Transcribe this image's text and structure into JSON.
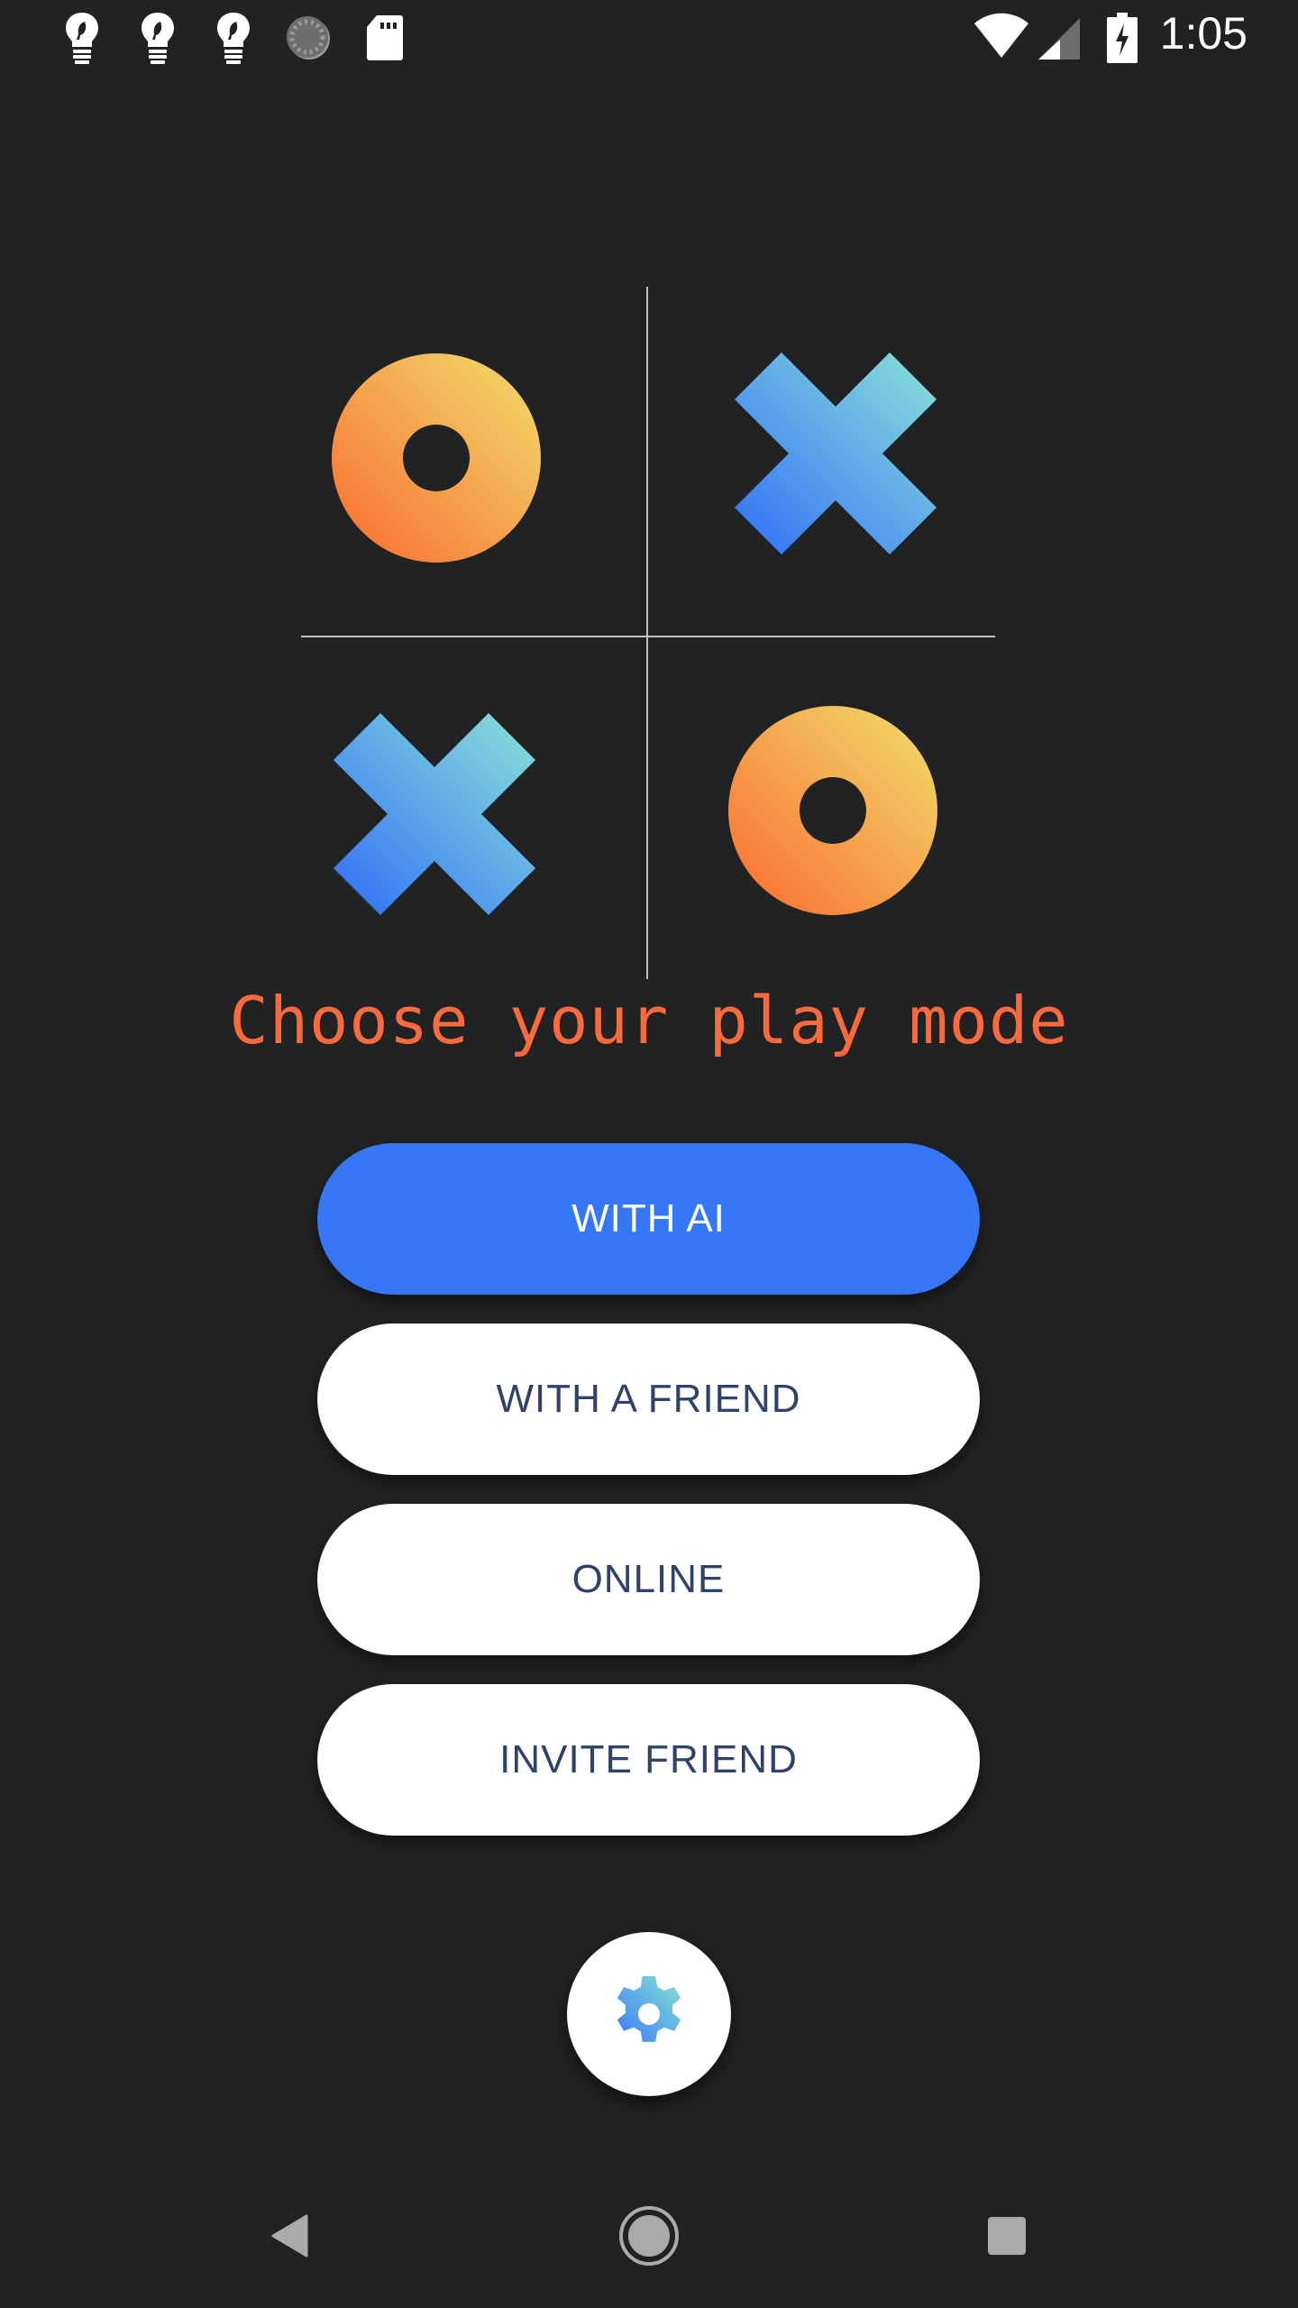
{
  "status_bar": {
    "time": "1:05",
    "left_icons": [
      "lightbulb-eco-icon",
      "lightbulb-eco-icon",
      "lightbulb-eco-icon",
      "sync-dial-icon",
      "sd-card-icon"
    ],
    "right_icons": [
      "wifi-icon",
      "cell-signal-icon",
      "battery-charging-icon"
    ]
  },
  "board": {
    "cells": [
      {
        "position": "top-left",
        "mark": "O"
      },
      {
        "position": "top-right",
        "mark": "X"
      },
      {
        "position": "bottom-left",
        "mark": "X"
      },
      {
        "position": "bottom-right",
        "mark": "O"
      }
    ],
    "colors": {
      "o_gradient_start": "#fb6a2f",
      "o_gradient_end": "#f0df6c",
      "x_gradient_start": "#2f6ef8",
      "x_gradient_end": "#8ae3d8",
      "grid_line": "#bfc1c3"
    }
  },
  "title": "Choose your play mode",
  "buttons": {
    "with_ai": "WITH AI",
    "with_friend": "WITH A FRIEND",
    "online": "ONLINE",
    "invite_friend": "INVITE FRIEND"
  },
  "settings_button": {
    "icon": "gear-icon"
  },
  "nav_bar": {
    "back": "back-icon",
    "home": "home-icon",
    "recents": "recents-icon"
  },
  "colors": {
    "background": "#202224",
    "accent": "#3677f6",
    "title": "#fa6a3c",
    "button_text_secondary": "#2f4369"
  }
}
